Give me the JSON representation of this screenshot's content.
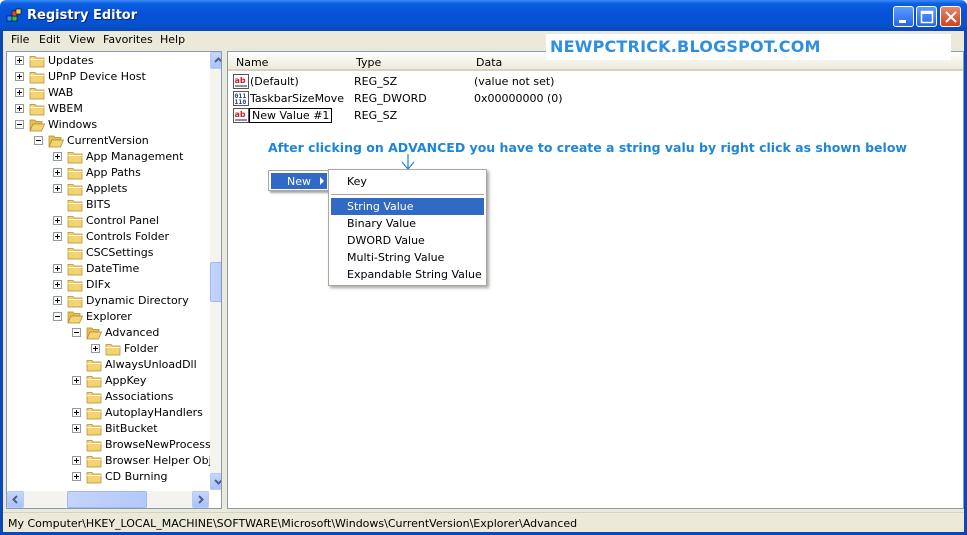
{
  "window": {
    "title": "Registry Editor"
  },
  "menu": [
    "File",
    "Edit",
    "View",
    "Favorites",
    "Help"
  ],
  "tree": [
    {
      "label": "Updates",
      "depth": 0,
      "toggle": "plus",
      "open": false
    },
    {
      "label": "UPnP Device Host",
      "depth": 0,
      "toggle": "plus",
      "open": false
    },
    {
      "label": "WAB",
      "depth": 0,
      "toggle": "plus",
      "open": false
    },
    {
      "label": "WBEM",
      "depth": 0,
      "toggle": "plus",
      "open": false
    },
    {
      "label": "Windows",
      "depth": 0,
      "toggle": "minus",
      "open": true
    },
    {
      "label": "CurrentVersion",
      "depth": 1,
      "toggle": "minus",
      "open": true
    },
    {
      "label": "App Management",
      "depth": 2,
      "toggle": "plus",
      "open": false
    },
    {
      "label": "App Paths",
      "depth": 2,
      "toggle": "plus",
      "open": false
    },
    {
      "label": "Applets",
      "depth": 2,
      "toggle": "plus",
      "open": false
    },
    {
      "label": "BITS",
      "depth": 2,
      "toggle": "none",
      "open": false
    },
    {
      "label": "Control Panel",
      "depth": 2,
      "toggle": "plus",
      "open": false
    },
    {
      "label": "Controls Folder",
      "depth": 2,
      "toggle": "plus",
      "open": false
    },
    {
      "label": "CSCSettings",
      "depth": 2,
      "toggle": "none",
      "open": false
    },
    {
      "label": "DateTime",
      "depth": 2,
      "toggle": "plus",
      "open": false
    },
    {
      "label": "DIFx",
      "depth": 2,
      "toggle": "plus",
      "open": false
    },
    {
      "label": "Dynamic Directory",
      "depth": 2,
      "toggle": "plus",
      "open": false
    },
    {
      "label": "Explorer",
      "depth": 2,
      "toggle": "minus",
      "open": true
    },
    {
      "label": "Advanced",
      "depth": 3,
      "toggle": "minus",
      "open": true
    },
    {
      "label": "Folder",
      "depth": 4,
      "toggle": "plus",
      "open": false
    },
    {
      "label": "AlwaysUnloadDll",
      "depth": 3,
      "toggle": "none",
      "open": false
    },
    {
      "label": "AppKey",
      "depth": 3,
      "toggle": "plus",
      "open": false
    },
    {
      "label": "Associations",
      "depth": 3,
      "toggle": "none",
      "open": false
    },
    {
      "label": "AutoplayHandlers",
      "depth": 3,
      "toggle": "plus",
      "open": false
    },
    {
      "label": "BitBucket",
      "depth": 3,
      "toggle": "plus",
      "open": false
    },
    {
      "label": "BrowseNewProcess",
      "depth": 3,
      "toggle": "none",
      "open": false
    },
    {
      "label": "Browser Helper Obje",
      "depth": 3,
      "toggle": "plus",
      "open": false
    },
    {
      "label": "CD Burning",
      "depth": 3,
      "toggle": "plus",
      "open": false
    }
  ],
  "columns": [
    "Name",
    "Type",
    "Data"
  ],
  "values": [
    {
      "name": "(Default)",
      "type": "REG_SZ",
      "data": "(value not set)",
      "icon": "string-value-icon"
    },
    {
      "name": "TaskbarSizeMove",
      "type": "REG_DWORD",
      "data": "0x00000000 (0)",
      "icon": "binary-value-icon"
    },
    {
      "name": "New Value #1",
      "type": "REG_SZ",
      "data": "",
      "icon": "string-value-icon"
    }
  ],
  "banner": "NEWPCTRICK.BLOGSPOT.COM",
  "annotation": "After clicking on ADVANCED  you have to create a string valu by right click  as shown below",
  "context_menu": {
    "label": "New"
  },
  "submenu": {
    "top": "Key",
    "items": [
      "String Value",
      "Binary Value",
      "DWORD Value",
      "Multi-String Value",
      "Expandable String Value"
    ],
    "highlighted": "String Value"
  },
  "status": "My Computer\\HKEY_LOCAL_MACHINE\\SOFTWARE\\Microsoft\\Windows\\CurrentVersion\\Explorer\\Advanced",
  "colors": {
    "titlebar": "#0553cf",
    "highlight": "#316ac5",
    "annotation": "#1e86d8",
    "banner": "#2f8fdf",
    "folder": "#f3d373"
  }
}
